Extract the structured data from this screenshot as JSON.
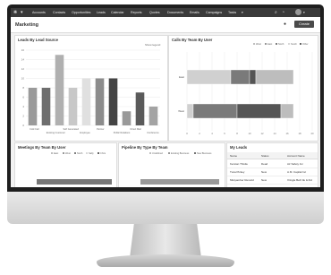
{
  "nav": {
    "items": [
      "Accounts",
      "Contacts",
      "Opportunities",
      "Leads",
      "Calendar",
      "Reports",
      "Quotes",
      "Documents",
      "Emails",
      "Campaigns",
      "Tasks"
    ]
  },
  "page": {
    "title": "Marketing",
    "create_label": "Create"
  },
  "leads_panel": {
    "title": "Leads By Lead Source",
    "option": "Show legend",
    "chart_data": {
      "type": "bar",
      "categories": [
        "Cold Call",
        "Existing Customer",
        "Self Generated",
        "Employee",
        "Partner",
        "Public Relations",
        "Direct Mail",
        "Conference",
        "Web Site",
        "Word of mouth",
        "Email",
        "Campaign",
        "Other"
      ],
      "visible_labels": [
        "Cold Call",
        "Existing Customer",
        "Self Generated",
        "Employee",
        "Partner",
        "Public Relations",
        "Direct Mail",
        "Conference"
      ],
      "values": [
        8,
        8,
        15,
        8,
        10,
        10,
        10,
        3,
        7,
        4
      ],
      "ylim": [
        0,
        16
      ],
      "colors": [
        "#9a9a9a",
        "#6e6e6e",
        "#b0b0b0",
        "#c8c8c8",
        "#e0e0e0",
        "#8c8c8c",
        "#444444",
        "#999999",
        "#5a5a5a",
        "#a3a3a3"
      ]
    }
  },
  "calls_panel": {
    "title": "Calls By Team By User",
    "legend": [
      "West",
      "East",
      "North",
      "South",
      "Other"
    ],
    "rows": [
      "East",
      "West"
    ],
    "chart_data": {
      "type": "bar",
      "orientation": "horizontal",
      "categories": [
        "East",
        "West"
      ],
      "series": [
        {
          "name": "West",
          "values": [
            7,
            1
          ]
        },
        {
          "name": "East",
          "values": [
            3,
            7
          ]
        },
        {
          "name": "North",
          "values": [
            1,
            7
          ]
        },
        {
          "name": "South",
          "values": [
            6,
            2
          ]
        }
      ],
      "xlim": [
        0,
        20
      ]
    }
  },
  "meetings_panel": {
    "title": "Meetings By Team By User",
    "legend": [
      "East",
      "West",
      "North",
      "Sally",
      "Chris"
    ]
  },
  "pipeline_panel": {
    "title": "Pipeline By Type By Team",
    "legend": [
      "Undefined",
      "Existing Business",
      "New Business"
    ]
  },
  "my_leads": {
    "title": "My Leads",
    "columns": [
      "Name",
      "Status",
      "Account Name"
    ],
    "rows": [
      [
        "Kerstan Thistle",
        "Dead",
        "Air Safety Inc"
      ],
      [
        "Tuna Pickey",
        "New",
        "A.M. Capital Inc"
      ],
      [
        "Mistyamber Remold",
        "New",
        "Xringle Bell Ink & Fid"
      ]
    ]
  }
}
